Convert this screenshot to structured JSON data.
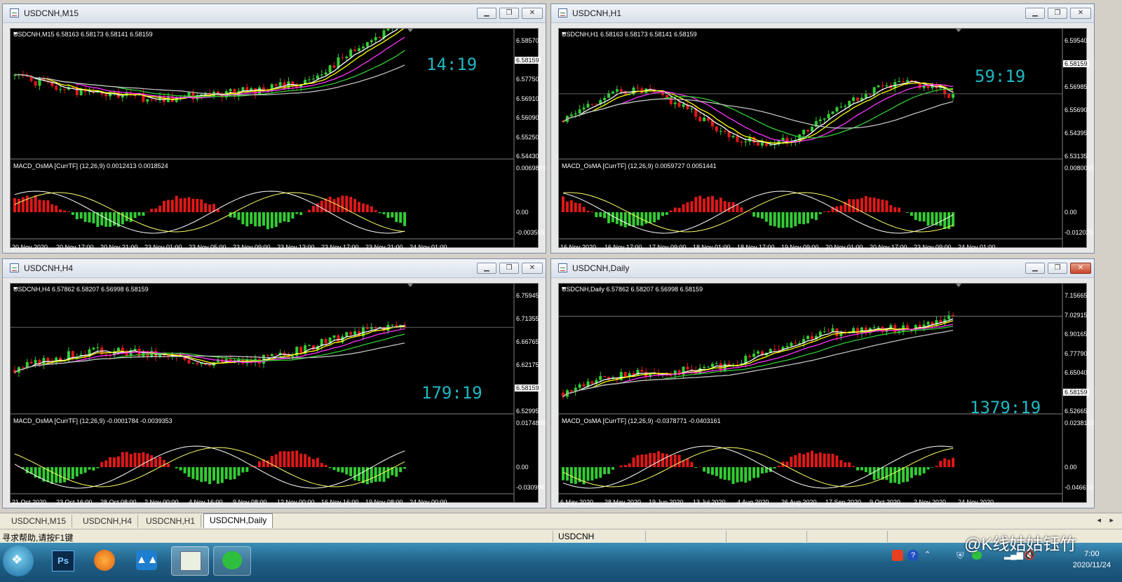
{
  "windows": [
    {
      "title": "USDCNH,M15",
      "header": "USDCNH,M15  6.58163 6.58173 6.58141 6.58159",
      "macd": "MACD_OsMA [CurrTF] (12,26,9) 0.0012413 0.0018524",
      "prices": [
        "6.58570",
        "6.58159",
        "6.57750",
        "6.56910",
        "6.56090",
        "6.55250",
        "6.54430"
      ],
      "macd_scale": [
        "0.0069869",
        "0.00",
        "-0.003555"
      ],
      "timer": "14:19",
      "times": [
        "20 Nov 2020",
        "20 Nov 17:00",
        "20 Nov 21:00",
        "23 Nov 01:00",
        "23 Nov 05:00",
        "23 Nov 09:00",
        "23 Nov 13:00",
        "23 Nov 17:00",
        "23 Nov 21:00",
        "24 Nov 01:00"
      ]
    },
    {
      "title": "USDCNH,H1",
      "header": "USDCNH,H1  6.58163 6.58173 6.58141 6.58159",
      "macd": "MACD_OsMA [CurrTF] (12,26,9) 0.0059727 0.0051441",
      "prices": [
        "6.59540",
        "6.58159",
        "6.56985",
        "6.55690",
        "6.54395",
        "6.53135"
      ],
      "macd_scale": [
        "0.0080055",
        "0.00",
        "-0.012025"
      ],
      "timer": "59:19",
      "times": [
        "16 Nov 2020",
        "16 Nov 17:00",
        "17 Nov 09:00",
        "18 Nov 01:00",
        "18 Nov 17:00",
        "19 Nov 09:00",
        "20 Nov 01:00",
        "20 Nov 17:00",
        "23 Nov 09:00",
        "24 Nov 01:00"
      ]
    },
    {
      "title": "USDCNH,H4",
      "header": "USDCNH,H4  6.57862 6.58207 6.56998 6.58159",
      "macd": "MACD_OsMA [CurrTF] (12,26,9) -0.0001784 -0.0039353",
      "prices": [
        "6.75945",
        "6.71355",
        "6.66765",
        "6.62175",
        "6.58159",
        "6.52995"
      ],
      "macd_scale": [
        "0.0174898",
        "0.00",
        "-0.030996"
      ],
      "timer": "179:19",
      "times": [
        "21 Oct 2020",
        "23 Oct 16:00",
        "28 Oct 08:00",
        "2 Nov 00:00",
        "4 Nov 16:00",
        "9 Nov 08:00",
        "12 Nov 00:00",
        "16 Nov 16:00",
        "19 Nov 08:00",
        "24 Nov 00:00"
      ]
    },
    {
      "title": "USDCNH,Daily",
      "header": "USDCNH,Daily  6.57862 6.58207 6.56998 6.58159",
      "macd": "MACD_OsMA [CurrTF] (12,26,9) -0.0378771 -0.0403161",
      "prices": [
        "7.15665",
        "7.02915",
        "6.90165",
        "6.77790",
        "6.65040",
        "6.58159",
        "6.52665"
      ],
      "macd_scale": [
        "0.0238165",
        "0.00",
        "-0.046614"
      ],
      "timer": "1379:19",
      "times": [
        "6 May 2020",
        "28 May 2020",
        "19 Jun 2020",
        "13 Jul 2020",
        "4 Aug 2020",
        "26 Aug 2020",
        "17 Sep 2020",
        "9 Oct 2020",
        "2 Nov 2020",
        "24 Nov 2020"
      ]
    }
  ],
  "tabs": [
    "USDCNH,M15",
    "USDCNH,H4",
    "USDCNH,H1",
    "USDCNH,Daily"
  ],
  "status": {
    "help": "寻求帮助,请按F1键",
    "symbol": "USDCNH"
  },
  "clock": {
    "time": "7:00",
    "date": "2020/11/24"
  },
  "watermark": "@K线姑姑钰竹",
  "colors": {
    "bull": "#33cc33",
    "bear": "#e01818",
    "timer": "#1fb8c4"
  }
}
